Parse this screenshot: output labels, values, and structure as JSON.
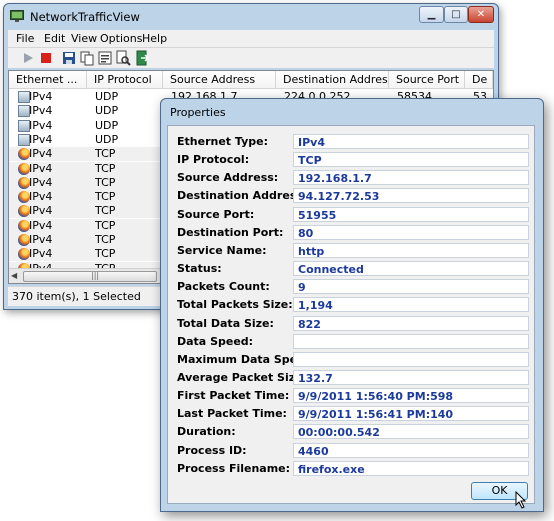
{
  "window": {
    "title": "NetworkTrafficView",
    "buttons": {
      "minimize": "▁",
      "maximize": "□",
      "close": "✕"
    }
  },
  "menu": [
    "File",
    "Edit",
    "View",
    "Options",
    "Help"
  ],
  "toolbar": [
    "play-icon",
    "stop-icon",
    "save-icon",
    "copy-icon",
    "properties-icon",
    "find-icon",
    "exit-icon"
  ],
  "list": {
    "columns": [
      "Ethernet ...",
      "IP Protocol",
      "Source Address",
      "Destination Address",
      "Source Port",
      "De"
    ],
    "rows": [
      {
        "icon": "network-icon",
        "ethernet": "IPv4",
        "protocol": "UDP",
        "source": "192.168.1.7",
        "dest": "224.0.0.252",
        "port": "58534",
        "de": "53"
      },
      {
        "icon": "network-icon",
        "ethernet": "IPv4",
        "protocol": "UDP",
        "source": "",
        "dest": "",
        "port": "",
        "de": ""
      },
      {
        "icon": "network-icon",
        "ethernet": "IPv4",
        "protocol": "UDP",
        "source": "",
        "dest": "",
        "port": "",
        "de": ""
      },
      {
        "icon": "network-icon",
        "ethernet": "IPv4",
        "protocol": "UDP",
        "source": "",
        "dest": "",
        "port": "",
        "de": ""
      },
      {
        "icon": "firefox-icon",
        "ethernet": "IPv4",
        "protocol": "TCP",
        "source": "",
        "dest": "",
        "port": "",
        "de": ""
      },
      {
        "icon": "firefox-icon",
        "ethernet": "IPv4",
        "protocol": "TCP",
        "source": "",
        "dest": "",
        "port": "",
        "de": ""
      },
      {
        "icon": "firefox-icon",
        "ethernet": "IPv4",
        "protocol": "TCP",
        "source": "",
        "dest": "",
        "port": "",
        "de": ""
      },
      {
        "icon": "firefox-icon",
        "ethernet": "IPv4",
        "protocol": "TCP",
        "source": "",
        "dest": "",
        "port": "",
        "de": ""
      },
      {
        "icon": "firefox-icon",
        "ethernet": "IPv4",
        "protocol": "TCP",
        "source": "",
        "dest": "",
        "port": "",
        "de": ""
      },
      {
        "icon": "firefox-icon",
        "ethernet": "IPv4",
        "protocol": "TCP",
        "source": "",
        "dest": "",
        "port": "",
        "de": ""
      },
      {
        "icon": "firefox-icon",
        "ethernet": "IPv4",
        "protocol": "TCP",
        "source": "",
        "dest": "",
        "port": "",
        "de": ""
      },
      {
        "icon": "firefox-icon",
        "ethernet": "IPv4",
        "protocol": "TCP",
        "source": "",
        "dest": "",
        "port": "",
        "de": ""
      },
      {
        "icon": "firefox-icon",
        "ethernet": "IPv4",
        "protocol": "TCP",
        "source": "",
        "dest": "",
        "port": "",
        "de": ""
      }
    ]
  },
  "status": "370 item(s), 1 Selected",
  "dialog": {
    "title": "Properties",
    "properties": [
      {
        "label": "Ethernet Type:",
        "value": "IPv4"
      },
      {
        "label": "IP Protocol:",
        "value": "TCP"
      },
      {
        "label": "Source Address:",
        "value": "192.168.1.7"
      },
      {
        "label": "Destination Address:",
        "value": "94.127.72.53"
      },
      {
        "label": "Source Port:",
        "value": "51955"
      },
      {
        "label": "Destination Port:",
        "value": "80"
      },
      {
        "label": "Service Name:",
        "value": "http"
      },
      {
        "label": "Status:",
        "value": "Connected"
      },
      {
        "label": "Packets Count:",
        "value": "9"
      },
      {
        "label": "Total Packets Size:",
        "value": "1,194"
      },
      {
        "label": "Total Data Size:",
        "value": "822"
      },
      {
        "label": "Data Speed:",
        "value": ""
      },
      {
        "label": "Maximum Data Speed:",
        "value": ""
      },
      {
        "label": "Average Packet Size:",
        "value": "132.7"
      },
      {
        "label": "First Packet Time:",
        "value": "9/9/2011 1:56:40 PM:598"
      },
      {
        "label": "Last Packet Time:",
        "value": "9/9/2011 1:56:41 PM:140"
      },
      {
        "label": "Duration:",
        "value": "00:00:00.542"
      },
      {
        "label": "Process ID:",
        "value": "4460"
      },
      {
        "label": "Process Filename:",
        "value": "firefox.exe"
      }
    ],
    "ok_label": "OK"
  },
  "colors": {
    "value_text": "#1c3a9b",
    "frame": "#bcd3e8",
    "selection": "#f0f0f0"
  }
}
